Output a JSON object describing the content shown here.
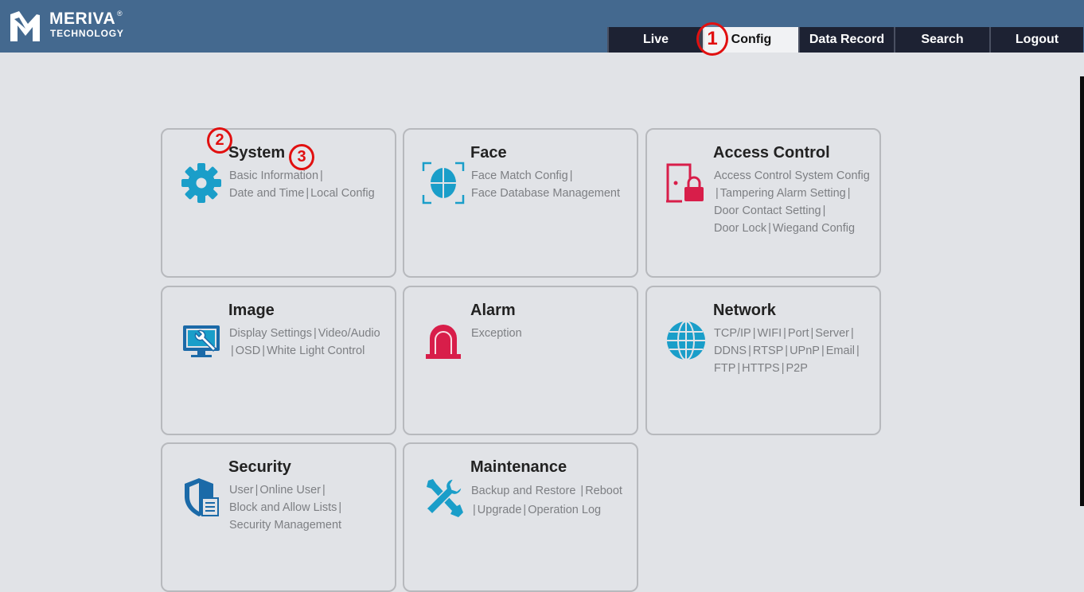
{
  "brand": {
    "name": "MERIVA",
    "reg_mark": "®",
    "subtitle": "TECHNOLOGY"
  },
  "nav": {
    "tabs": [
      {
        "label": "Live",
        "active": false
      },
      {
        "label": "Config",
        "active": true
      },
      {
        "label": "Data Record",
        "active": false
      },
      {
        "label": "Search",
        "active": false
      },
      {
        "label": "Logout",
        "active": false
      }
    ]
  },
  "annotations": [
    "1",
    "2",
    "3"
  ],
  "cards": [
    {
      "title": "System",
      "icon": "gear-icon",
      "links": [
        "Basic Information",
        "Date and Time",
        "Local Config"
      ]
    },
    {
      "title": "Face",
      "icon": "face-scan-icon",
      "links": [
        "Face Match Config",
        "Face Database Management"
      ]
    },
    {
      "title": "Access Control",
      "icon": "door-lock-icon",
      "links": [
        "Access Control System Config",
        "Tampering Alarm Setting",
        "Door Contact Setting",
        "Door Lock",
        "Wiegand Config"
      ]
    },
    {
      "title": "Image",
      "icon": "monitor-wrench-icon",
      "links": [
        "Display Settings",
        "Video/Audio",
        "OSD",
        "White Light Control"
      ]
    },
    {
      "title": "Alarm",
      "icon": "alarm-light-icon",
      "links": [
        "Exception"
      ]
    },
    {
      "title": "Network",
      "icon": "globe-icon",
      "links": [
        "TCP/IP",
        "WIFI",
        "Port",
        "Server",
        "DDNS",
        "RTSP",
        "UPnP",
        "Email",
        "FTP",
        "HTTPS",
        "P2P"
      ]
    },
    {
      "title": "Security",
      "icon": "shield-document-icon",
      "links": [
        "User",
        "Online User",
        "Block and Allow Lists",
        "Security Management"
      ]
    },
    {
      "title": "Maintenance",
      "icon": "tools-icon",
      "links": [
        "Backup and Restore",
        "Reboot",
        "Upgrade",
        "Operation Log"
      ]
    }
  ],
  "colors": {
    "header": "#44698f",
    "nav_tab": "#1d2233",
    "teal_icon": "#1a9ec9",
    "red_icon": "#d81e4a",
    "annotation": "#e11010"
  }
}
